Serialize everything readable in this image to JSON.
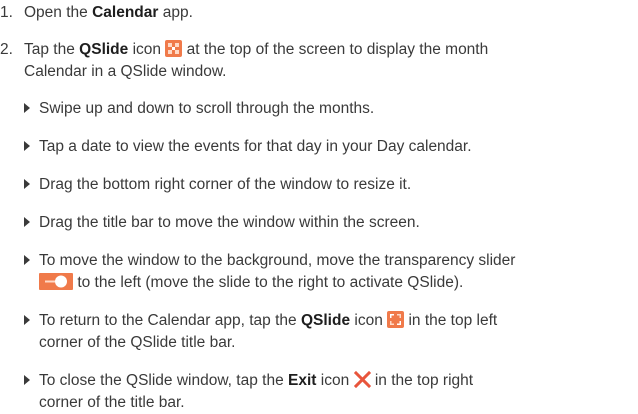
{
  "colors": {
    "text": "#3a3a3a",
    "icon_orange": "#f07a4a",
    "exit_red": "#e8553c"
  },
  "step1": {
    "number": "1.",
    "prefix": "Open the",
    "app": "Calendar",
    "suffix": "app."
  },
  "step2": {
    "number": "2.",
    "prefix": "Tap the",
    "qslide": "QSlide",
    "icon_word": "icon",
    "suffix": "at the top of the screen to display the month",
    "line2": "Calendar in a QSlide window."
  },
  "bullets": {
    "b1": "Swipe up and down to scroll through the months.",
    "b2": "Tap a date to view the events for that day in your Day calendar.",
    "b3": "Drag the bottom right corner of the window to resize it.",
    "b4": "Drag the title bar to move the window within the screen.",
    "b5_line1": "To move the window to the background, move the transparency slider",
    "b5_line2": "to the left (move the slide to the right to activate QSlide).",
    "b6_prefix": "To return to the Calendar app, tap the",
    "b6_qslide": "QSlide",
    "b6_icon_word": "icon",
    "b6_suffix": "in the top left",
    "b6_line2": "corner of the QSlide title bar.",
    "b7_prefix": "To close the QSlide window, tap the",
    "b7_exit": "Exit",
    "b7_icon_word": "icon",
    "b7_suffix": "in the top right",
    "b7_line2": "corner of the title bar."
  },
  "icons": {
    "qslide": "qslide-icon",
    "slider": "transparency-slider-icon",
    "exit": "exit-icon"
  }
}
